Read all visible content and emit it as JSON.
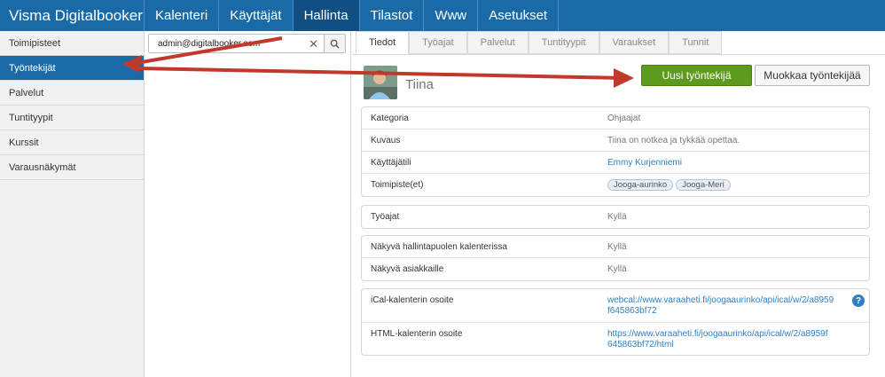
{
  "brand": "Visma Digitalbooker",
  "nav": [
    "Kalenteri",
    "Käyttäjät",
    "Hallinta",
    "Tilastot",
    "Www",
    "Asetukset"
  ],
  "sidebar": [
    "Toimipisteet",
    "Työntekijät",
    "Palvelut",
    "Tuntityypit",
    "Kurssit",
    "Varausnäkymät"
  ],
  "search": {
    "value": "admin@digitalbooker.com"
  },
  "tabs": [
    "Tiedot",
    "Työajat",
    "Palvelut",
    "Tuntityypit",
    "Varaukset",
    "Tunnit"
  ],
  "person": {
    "name": "Tiina"
  },
  "buttons": {
    "new": "Uusi työntekijä",
    "edit": "Muokkaa työntekijää"
  },
  "details": {
    "kategoria_label": "Kategoria",
    "kategoria": "Ohjaajat",
    "kuvaus_label": "Kuvaus",
    "kuvaus": "Tiina on notkea ja tykkää opettaa.",
    "kayttajatili_label": "Käyttäjätili",
    "kayttajatili": "Emmy Kurjenniemi",
    "toimipisteet_label": "Toimipiste(et)",
    "toimipisteet": [
      "Jooga-aurinko",
      "Jooga-Meri"
    ]
  },
  "tyoajat": {
    "label": "Työajat",
    "value": "Kyllä"
  },
  "visibility": {
    "hallinta_label": "Näkyvä hallintapuolen kalenterissa",
    "hallinta": "Kyllä",
    "asiakkaille_label": "Näkyvä asiakkaille",
    "asiakkaille": "Kyllä"
  },
  "calendars": {
    "ical_label": "iCal-kalenterin osoite",
    "ical_line1": "webcal://www.varaaheti.fi/joogaaurinko/api/ical/w/2/a8959",
    "ical_line2": "f645863bf72",
    "html_label": "HTML-kalenterin osoite",
    "html_line1": "https://www.varaaheti.fi/joogaaurinko/api/ical/w/2/a8959f",
    "html_line2": "645863bf72/html",
    "help_glyph": "?"
  },
  "colors": {
    "nav": "#1a6aa8",
    "active": "#0f4f83",
    "green": "#5d9a1e",
    "arrow": "#c0392b",
    "link": "#2f7fc1"
  }
}
